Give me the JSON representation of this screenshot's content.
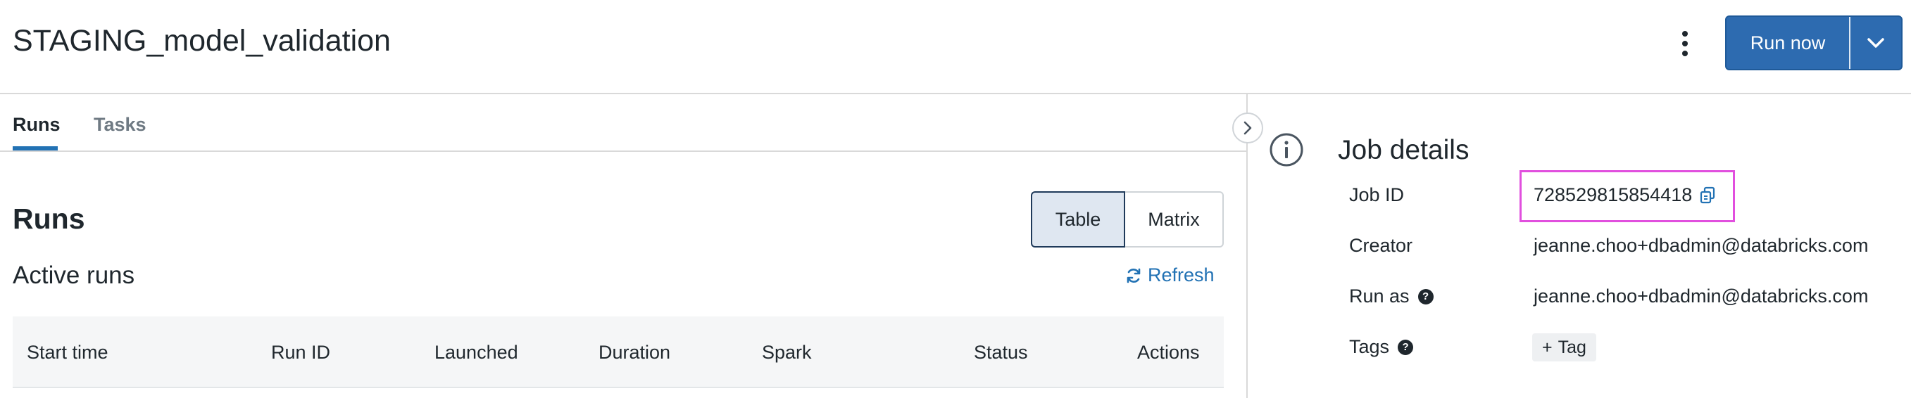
{
  "header": {
    "title": "STAGING_model_validation",
    "more_icon": "kebab-vertical-icon",
    "run_now_label": "Run now",
    "run_caret_icon": "chevron-down-icon",
    "accent": "#2d6bb0"
  },
  "tabs": [
    {
      "label": "Runs",
      "active": true
    },
    {
      "label": "Tasks",
      "active": false
    }
  ],
  "runs": {
    "heading": "Runs",
    "view_toggle": [
      "Table",
      "Matrix"
    ],
    "selected_view": "Table",
    "active_runs_title": "Active runs",
    "refresh_label": "Refresh",
    "columns": [
      "Start time",
      "Run ID",
      "Launched",
      "Duration",
      "Spark",
      "Status",
      "Actions"
    ]
  },
  "details": {
    "title": "Job details",
    "job_id_label": "Job ID",
    "job_id": "728529815854418",
    "creator_label": "Creator",
    "creator": "jeanne.choo+dbadmin@databricks.com",
    "run_as_label": "Run as",
    "run_as": "jeanne.choo+dbadmin@databricks.com",
    "tags_label": "Tags",
    "add_tag_label": "Tag",
    "highlight_color": "#e14fde"
  }
}
